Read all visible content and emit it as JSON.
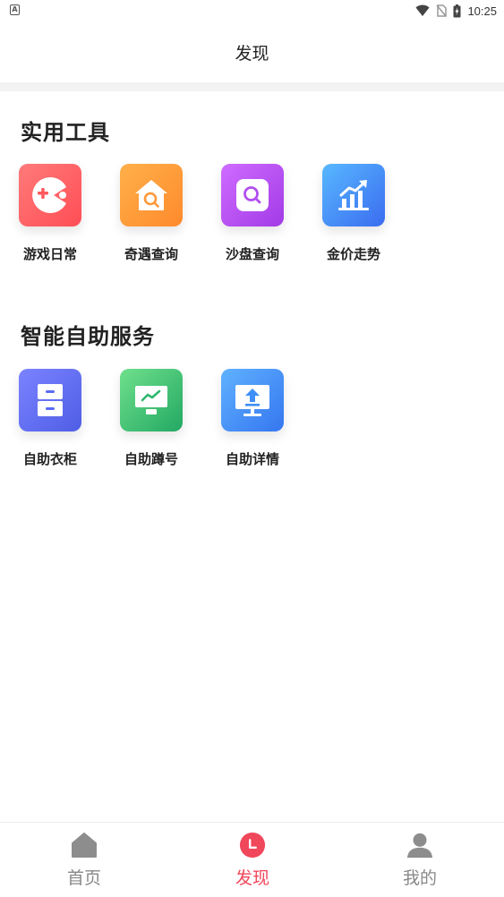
{
  "status_bar": {
    "time": "10:25"
  },
  "header": {
    "title": "发现"
  },
  "sections": [
    {
      "title": "实用工具",
      "items": [
        {
          "label": "游戏日常",
          "icon": "gamepad-icon"
        },
        {
          "label": "奇遇查询",
          "icon": "house-search-icon"
        },
        {
          "label": "沙盘查询",
          "icon": "search-icon"
        },
        {
          "label": "金价走势",
          "icon": "trend-chart-icon"
        }
      ]
    },
    {
      "title": "智能自助服务",
      "items": [
        {
          "label": "自助衣柜",
          "icon": "cabinet-icon"
        },
        {
          "label": "自助蹲号",
          "icon": "monitor-chart-icon"
        },
        {
          "label": "自助详情",
          "icon": "monitor-upload-icon"
        }
      ]
    }
  ],
  "tabbar": {
    "items": [
      {
        "label": "首页",
        "icon": "home-icon",
        "active": false
      },
      {
        "label": "发现",
        "icon": "discover-icon",
        "active": true
      },
      {
        "label": "我的",
        "icon": "user-icon",
        "active": false
      }
    ]
  },
  "colors": {
    "accent": "#f0475a",
    "tile_red": "#ff5a5f",
    "tile_orange": "#ff9838",
    "tile_purple": "#b14ff0",
    "tile_blue": "#3f82f7",
    "tile_indigo": "#5b6cf2",
    "tile_green": "#2fb86d",
    "tile_skyblue": "#3f8ff6"
  }
}
